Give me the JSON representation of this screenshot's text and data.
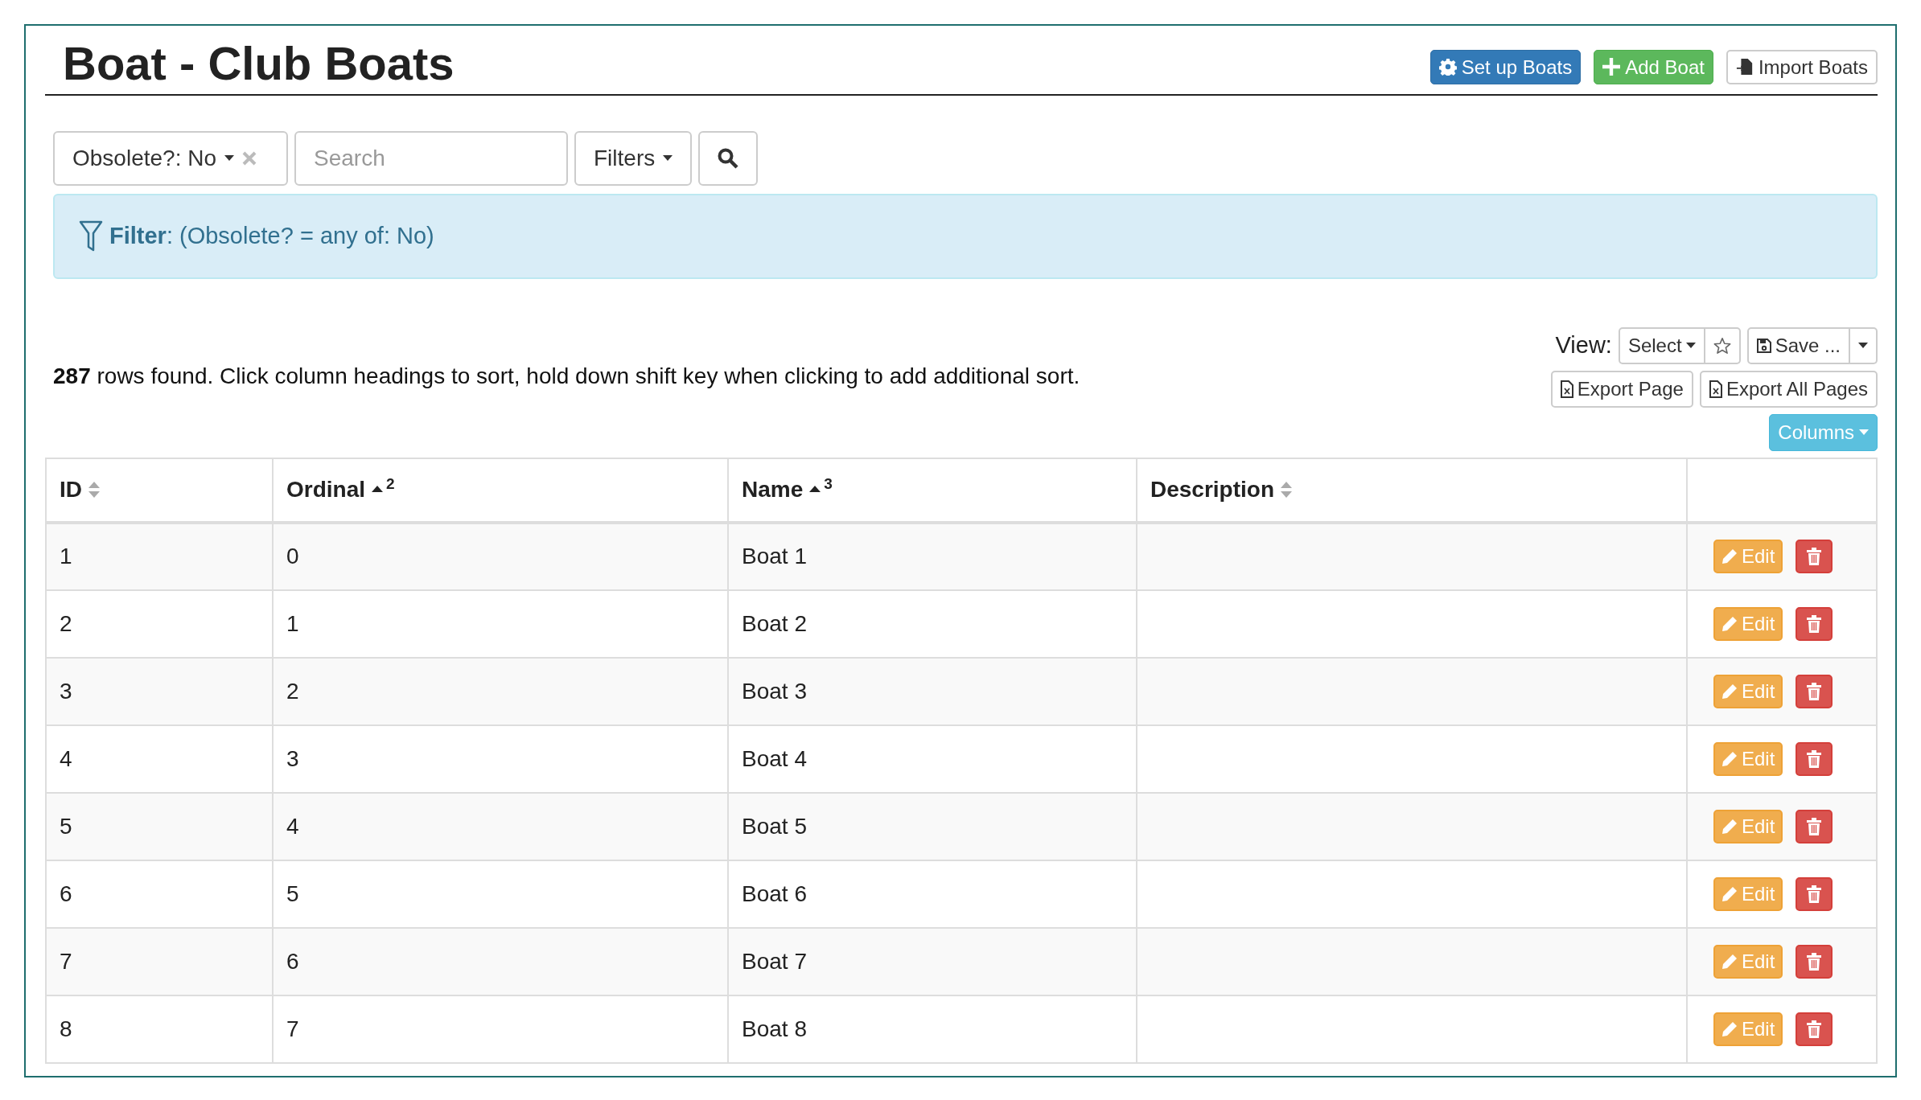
{
  "page": {
    "title": "Boat - Club Boats"
  },
  "header_buttons": [
    {
      "kind": "setup",
      "label": "Set up Boats"
    },
    {
      "kind": "add",
      "label": "Add Boat"
    },
    {
      "kind": "import",
      "label": "Import Boats"
    }
  ],
  "filter_bar": {
    "chip": "Obsolete?: No",
    "search": {
      "placeholder": "Search"
    },
    "filters": "Filters"
  },
  "filter_alert": {
    "text": "**Filter**: (Obsolete? = any of: No)"
  },
  "summary": "**287** rows found. Click column headings to sort, hold down shift key when clicking to add additional sort.",
  "view": {
    "label": "View:",
    "select": "Select",
    "save": "Save ...",
    "export_page": "Export Page",
    "export_all": "Export All Pages",
    "columns": "Columns"
  },
  "table": {
    "columns": [
      {
        "label": "ID",
        "sorted": false
      },
      {
        "label": "Ordinal",
        "sorted": true,
        "sort_order": "2"
      },
      {
        "label": "Name",
        "sorted": true,
        "sort_order": "3"
      },
      {
        "label": "Description",
        "sorted": false
      }
    ],
    "rows": [
      {
        "id": "1",
        "ordinal": "0",
        "name": "Boat 1",
        "edit": "Edit"
      },
      {
        "id": "2",
        "ordinal": "1",
        "name": "Boat 2",
        "edit": "Edit"
      },
      {
        "id": "3",
        "ordinal": "2",
        "name": "Boat 3",
        "edit": "Edit"
      },
      {
        "id": "4",
        "ordinal": "3",
        "name": "Boat 4",
        "edit": "Edit"
      },
      {
        "id": "5",
        "ordinal": "4",
        "name": "Boat 5",
        "edit": "Edit"
      },
      {
        "id": "6",
        "ordinal": "5",
        "name": "Boat 6",
        "edit": "Edit"
      },
      {
        "id": "7",
        "ordinal": "6",
        "name": "Boat 7",
        "edit": "Edit"
      },
      {
        "id": "8",
        "ordinal": "7",
        "name": "Boat 8",
        "edit": "Edit"
      }
    ]
  }
}
